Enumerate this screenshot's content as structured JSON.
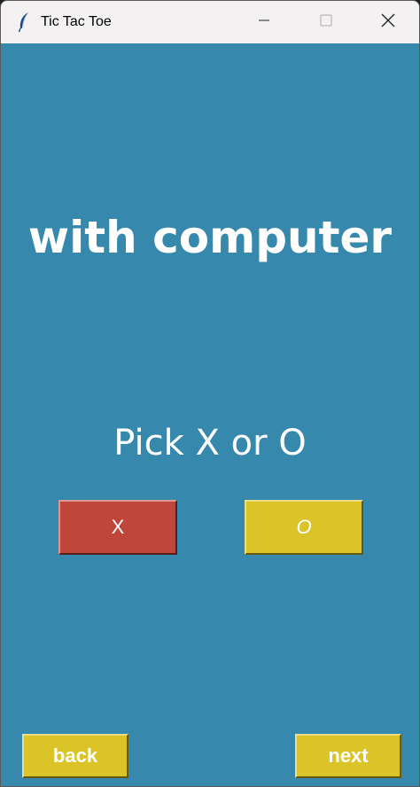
{
  "window": {
    "title": "Tic Tac Toe",
    "app_icon": "feather-icon",
    "controls": {
      "minimize_icon": "minimize-icon",
      "maximize_icon": "maximize-icon",
      "close_icon": "close-icon"
    }
  },
  "main": {
    "heading": "with computer",
    "prompt": "Pick X or O",
    "x_button_label": "X",
    "o_button_label": "O",
    "back_label": "back",
    "next_label": "next"
  },
  "colors": {
    "background": "#3689ad",
    "x_button": "#c0463b",
    "o_button": "#dbc428",
    "nav_button": "#dbc428",
    "text": "#ffffff"
  }
}
